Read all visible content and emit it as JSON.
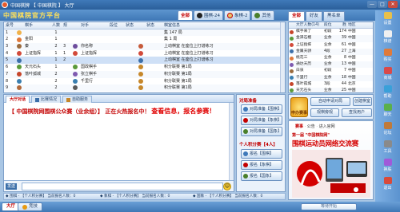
{
  "window": {
    "title": "中国棋牌 【 中国棋院 】 大厅",
    "min": "—",
    "max": "□",
    "close": "✕"
  },
  "brand": "中国棋院官方平台",
  "tabs": [
    {
      "label": "全部",
      "color": "#2b5f9a"
    },
    {
      "label": "围棋-24",
      "color": "#222222"
    },
    {
      "label": "象棋-2",
      "color": "#c30000"
    },
    {
      "label": "其他",
      "color": "#4a7f2a"
    }
  ],
  "right_tabs": [
    "全部",
    "好友",
    "黑名单"
  ],
  "table": {
    "headers": [
      "桌号",
      "",
      "棋手",
      "人数",
      "规",
      "",
      "对手",
      "段位",
      "状态",
      "",
      "状态",
      "棋室信息"
    ],
    "rows": [
      {
        "no": "1",
        "p1": "",
        "n": "1",
        "rule": "",
        "p2": "",
        "rank": "",
        "st": "",
        "st2": "",
        "info": "集 147 局",
        "av": "#f1b24a",
        "av2": "",
        "av3": "",
        "sel": false
      },
      {
        "no": "2",
        "p1": "金阳",
        "n": "1",
        "rule": "",
        "p2": "",
        "rank": "",
        "st": "",
        "st2": "",
        "info": "集 1 局",
        "av": "#e0783a",
        "av2": "",
        "av3": "",
        "sel": false
      },
      {
        "no": "3",
        "p1": "秦",
        "n": "2",
        "rule": "3",
        "p2": "你名称",
        "rank": "",
        "st": "",
        "st2": "",
        "info": "上动棋室 在座位上打谱练习",
        "av": "#9b6b3d",
        "av2": "#6d4c9c",
        "av3": "#c65a3a",
        "sel": false
      },
      {
        "no": "4",
        "p1": "上证指挥",
        "n": "1",
        "rule": "1",
        "p2": "上证指挥",
        "rank": "",
        "st": "",
        "st2": "",
        "info": "上动棋室 在座位上打谱练习",
        "av": "#d24a3a",
        "av2": "#d24a3a",
        "av3": "#d24a3a",
        "sel": false
      },
      {
        "no": "5",
        "p1": "",
        "n": "1",
        "rule": "2",
        "p2": "",
        "rank": "",
        "st": "",
        "st2": "",
        "info": "上动棋室 在座位上打谱练习",
        "av": "#3c6fa9",
        "av2": "",
        "av3": "#3c6fa9",
        "sel": true
      },
      {
        "no": "6",
        "p1": "天元石头",
        "n": "1",
        "rule": "",
        "p2": "国政棋手",
        "rank": "",
        "st": "",
        "st2": "",
        "info": "积分联赛 第1局",
        "av": "#5a9a3a",
        "av2": "#5a9a3a",
        "av3": "#c6872a",
        "sel": false
      },
      {
        "no": "7",
        "p1": "落叶孤城",
        "n": "2",
        "rule": "",
        "p2": "张立棋手",
        "rank": "",
        "st": "",
        "st2": "",
        "info": "积分联赛 第1局",
        "av": "#c6452a",
        "av2": "#7f5ab0",
        "av3": "#c6872a",
        "sel": false
      },
      {
        "no": "8",
        "p1": "",
        "n": "2",
        "rule": "",
        "p2": "千里行",
        "rank": "",
        "st": "",
        "st2": "",
        "info": "积分联赛 第1局",
        "av": "#3a7fb0",
        "av2": "#3a7fb0",
        "av3": "#c6872a",
        "sel": false
      },
      {
        "no": "9",
        "p1": "",
        "n": "2",
        "rule": "",
        "p2": "",
        "rank": "",
        "st": "",
        "st2": "",
        "info": "积分联赛 第1局",
        "av": "#b0683a",
        "av2": "#5a5a5a",
        "av3": "#c6872a",
        "sel": false
      }
    ]
  },
  "chat": {
    "tabs": [
      "大厅对话",
      "比赛情况",
      "自助服务"
    ],
    "message_prefix": "【 中国棋院网围棋公众赛（业余组）】 正在火热报名中！",
    "message_warn": "查看信息，报名参赛！",
    "send_label": "发送",
    "input_placeholder": "",
    "smiley": "☺"
  },
  "match_panel": {
    "title1": "对局准备",
    "buttons_top": [
      "对局准备【围棋】",
      "对局准备【象棋】",
      "对局准备【国象】"
    ],
    "title2": "个人积分赛【4人】",
    "buttons_bottom": [
      "报名【围棋】",
      "报名【象棋】",
      "报名【国象】"
    ]
  },
  "status": {
    "left": "◆ 围棋 - 【个人积分赛】 当前报名人数：0",
    "mid": "◆ 象棋 - 【个人积分赛】 当前报名人数：0",
    "right": "◆ 国象 - 【个人积分赛】 当前报名人数：0"
  },
  "bottom_tabs": [
    "大厅",
    "竞技"
  ],
  "wait_button": "等待开始",
  "users": {
    "headers": [
      "",
      "大厅人数(14)",
      "段位",
      "胜",
      "地区"
    ],
    "rows": [
      {
        "name": "棋手来了",
        "rank": "初段",
        "num": "174",
        "loc": "中国",
        "av": "#c6452a"
      },
      {
        "name": "金泽石榴",
        "rank": "业余",
        "num": "39",
        "loc": "中国",
        "av": "#5a9a3a"
      },
      {
        "name": "上证指挥",
        "rank": "业余",
        "num": "61",
        "loc": "中国",
        "av": "#d24a3a"
      },
      {
        "name": "金属天骄",
        "rank": "4段",
        "num": "27",
        "loc": "上海",
        "av": "#3c6fa9"
      },
      {
        "name": "桃花三",
        "rank": "业余",
        "num": "8",
        "loc": "中国",
        "av": "#e0783a"
      },
      {
        "name": "通达天历",
        "rank": "业余",
        "num": "13",
        "loc": "中国",
        "av": "#7f5ab0"
      },
      {
        "name": "白泉",
        "rank": "初段",
        "num": "7",
        "loc": "中国",
        "av": "#9b6b3d"
      },
      {
        "name": "千里行",
        "rank": "业余",
        "num": "18",
        "loc": "中国",
        "av": "#3a7fb0"
      },
      {
        "name": "落叶孤城",
        "rank": "3段",
        "num": "44",
        "loc": "北京",
        "av": "#c6452a"
      },
      {
        "name": "天元石头",
        "rank": "业余",
        "num": "25",
        "loc": "中国",
        "av": "#5a9a3a"
      }
    ]
  },
  "actions": {
    "sign_up": "申办赛事",
    "auto_match": "自动申请对局",
    "create_room": "创建棋室",
    "watch": "观棋旁观",
    "find_user": "查找用户"
  },
  "ad": {
    "line1_a": "赛事",
    "line1_b": "公告",
    "line1_c": "进入官网",
    "line2": "第一届 \"中国棋院网\"",
    "line3": "围棋运动员网络交流赛"
  },
  "sidebar": [
    "设置",
    "棋谱",
    "购买",
    "商城",
    "帮助",
    "聊天",
    "论坛",
    "工具",
    "换肤",
    "退出"
  ]
}
